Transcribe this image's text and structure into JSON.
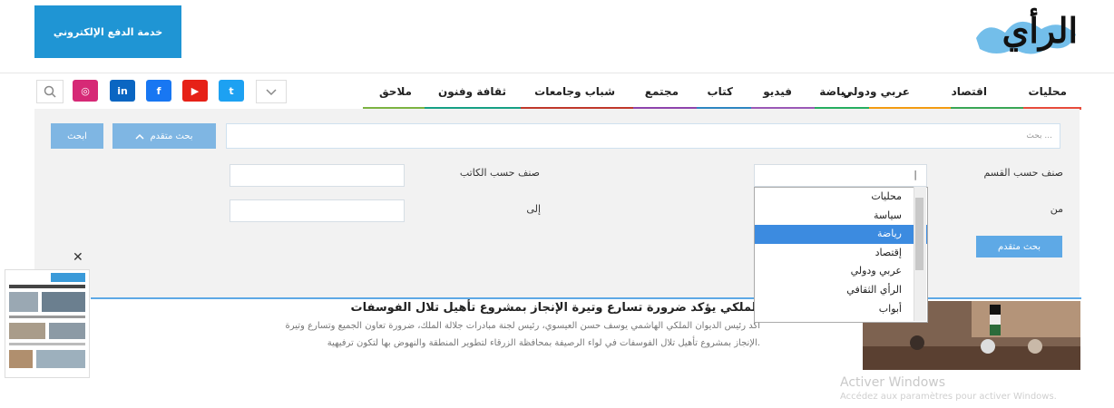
{
  "header": {
    "pay_button": "خدمة الدفع الإلكتروني",
    "logo_text": "الرأي"
  },
  "nav": {
    "items": [
      {
        "label": "محليات",
        "color": "#e74c3c"
      },
      {
        "label": "اقتصاد",
        "color": "#3aa655"
      },
      {
        "label": "عربي ودولي",
        "color": "#f39c12"
      },
      {
        "label": "رياضة",
        "color": "#27ae60"
      },
      {
        "label": "فيديو",
        "color": "#9b59b6"
      },
      {
        "label": "كتاب",
        "color": "#2e86c1"
      },
      {
        "label": "مجتمع",
        "color": "#8e44ad"
      },
      {
        "label": "شباب وجامعات",
        "color": "#c0392b"
      },
      {
        "label": "ثقافة وفنون",
        "color": "#16a085"
      },
      {
        "label": "ملاحق",
        "color": "#7cb342"
      }
    ],
    "social": [
      {
        "icon": "twitter-icon",
        "glyph": "t",
        "color": "#1da1f2"
      },
      {
        "icon": "youtube-icon",
        "glyph": "▶",
        "color": "#e62117"
      },
      {
        "icon": "facebook-icon",
        "glyph": "f",
        "color": "#1877f2"
      },
      {
        "icon": "linkedin-icon",
        "glyph": "in",
        "color": "#0a66c2"
      },
      {
        "icon": "instagram-icon",
        "glyph": "◎",
        "color": "#d62976"
      }
    ]
  },
  "search": {
    "placeholder": "بحث ...",
    "advanced_label": "بحث متقدم",
    "search_label": "ابحث",
    "category_label": "صنف حسب القسم",
    "writer_label": "صنف حسب الكاتب",
    "from_label": "من",
    "to_label": "إلى",
    "advanced_submit": "بحث متقدم"
  },
  "dropdown": {
    "options": [
      "محليات",
      "سياسة",
      "رياضة",
      "إقتصاد",
      "عربي ودولي",
      "الرأي الثقافي",
      "أبواب"
    ],
    "selected": "رياضة"
  },
  "article": {
    "title": "الملكي يؤكد ضرورة تسارع وتيرة الإنجاز بمشروع تأهيل تلال الفوسفات",
    "summary_line1": "أكد رئيس الديوان الملكي الهاشمي يوسف حسن العيسوي، رئيس لجنة مبادرات جلالة الملك، ضرورة تعاون الجميع وتسارع وتيرة",
    "summary_line2": "الإنجاز بمشروع تأهيل تلال الفوسفات في لواء الرصيفة بمحافظة الزرقاء لتطوير المنطقة والنهوض بها لتكون ترفيهية."
  },
  "popup": {
    "close": "✕"
  },
  "watermark": {
    "line1": "Activer Windows",
    "line2": "Accédez aux paramètres pour activer Windows."
  }
}
